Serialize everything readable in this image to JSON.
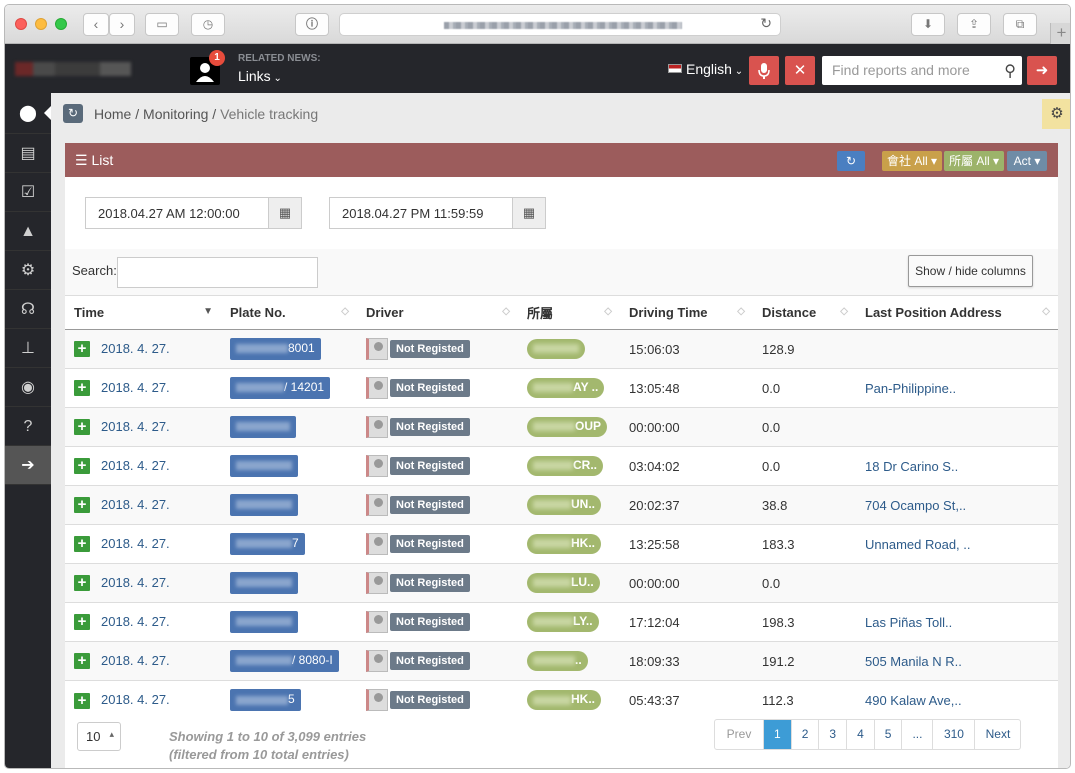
{
  "header": {
    "related_news_label": "RELATED NEWS:",
    "links_label": "Links",
    "notification_count": "1",
    "language": "English",
    "search_placeholder": "Find reports and more"
  },
  "breadcrumb": {
    "home": "Home",
    "monitoring": "Monitoring",
    "current": "Vehicle tracking"
  },
  "panel": {
    "title": "List",
    "company_filter": "會社 All",
    "belong_filter": "所屬 All",
    "act_label": "Act"
  },
  "filters": {
    "start_datetime": "2018.04.27 AM 12:00:00",
    "end_datetime": "2018.04.27 PM 11:59:59",
    "search_label": "Search:",
    "show_hide_label": "Show / hide columns"
  },
  "table": {
    "columns": [
      "Time",
      "Plate No.",
      "Driver",
      "所屬",
      "Driving Time",
      "Distance",
      "Last Position Address"
    ],
    "rows": [
      {
        "time": "2018. 4. 27.",
        "plate_suffix": "8001",
        "driver": "Not Registed",
        "group_suffix": "",
        "driving_time": "15:06:03",
        "distance": "128.9",
        "address": ""
      },
      {
        "time": "2018. 4. 27.",
        "plate_suffix": "/ 14201",
        "driver": "Not Registed",
        "group_suffix": "AY ..",
        "driving_time": "13:05:48",
        "distance": "0.0",
        "address": "Pan-Philippine.."
      },
      {
        "time": "2018. 4. 27.",
        "plate_suffix": "",
        "driver": "Not Registed",
        "group_suffix": "OUP",
        "driving_time": "00:00:00",
        "distance": "0.0",
        "address": ""
      },
      {
        "time": "2018. 4. 27.",
        "plate_suffix": "",
        "driver": "Not Registed",
        "group_suffix": "CR..",
        "driving_time": "03:04:02",
        "distance": "0.0",
        "address": "18 Dr Carino S.."
      },
      {
        "time": "2018. 4. 27.",
        "plate_suffix": "",
        "driver": "Not Registed",
        "group_suffix": "UN..",
        "driving_time": "20:02:37",
        "distance": "38.8",
        "address": "704 Ocampo St,.."
      },
      {
        "time": "2018. 4. 27.",
        "plate_suffix": "7",
        "driver": "Not Registed",
        "group_suffix": "HK..",
        "driving_time": "13:25:58",
        "distance": "183.3",
        "address": "Unnamed Road, .."
      },
      {
        "time": "2018. 4. 27.",
        "plate_suffix": "",
        "driver": "Not Registed",
        "group_suffix": "LU..",
        "driving_time": "00:00:00",
        "distance": "0.0",
        "address": ""
      },
      {
        "time": "2018. 4. 27.",
        "plate_suffix": "",
        "driver": "Not Registed",
        "group_suffix": "LY..",
        "driving_time": "17:12:04",
        "distance": "198.3",
        "address": "Las Piñas Toll.."
      },
      {
        "time": "2018. 4. 27.",
        "plate_suffix": "/ 8080-I",
        "driver": "Not Registed",
        "group_suffix": "..",
        "driving_time": "18:09:33",
        "distance": "191.2",
        "address": "505 Manila N R.."
      },
      {
        "time": "2018. 4. 27.",
        "plate_suffix": "5",
        "driver": "Not Registed",
        "group_suffix": "HK..",
        "driving_time": "05:43:37",
        "distance": "112.3",
        "address": "490 Kalaw Ave,.."
      }
    ]
  },
  "footer": {
    "page_length": "10",
    "info_line1": "Showing 1 to 10 of 3,099 entries",
    "info_line2": "(filtered from 10 total entries)",
    "pages": [
      "Prev",
      "1",
      "2",
      "3",
      "4",
      "5",
      "...",
      "310",
      "Next"
    ],
    "active_page": "1"
  },
  "icons": [
    "map-marker-icon",
    "file-icon",
    "calendar-check-icon",
    "road-icon",
    "gear-icon",
    "headset-icon",
    "sitemap-icon",
    "github-icon",
    "question-icon",
    "arrow-right-icon"
  ],
  "colors": {
    "panel_header": "#9c5c5c",
    "sidebar": "#25262b",
    "danger": "#d9534f",
    "plate": "#4b74b0",
    "group": "#a3b86e",
    "active_page": "#3d9cd6"
  }
}
